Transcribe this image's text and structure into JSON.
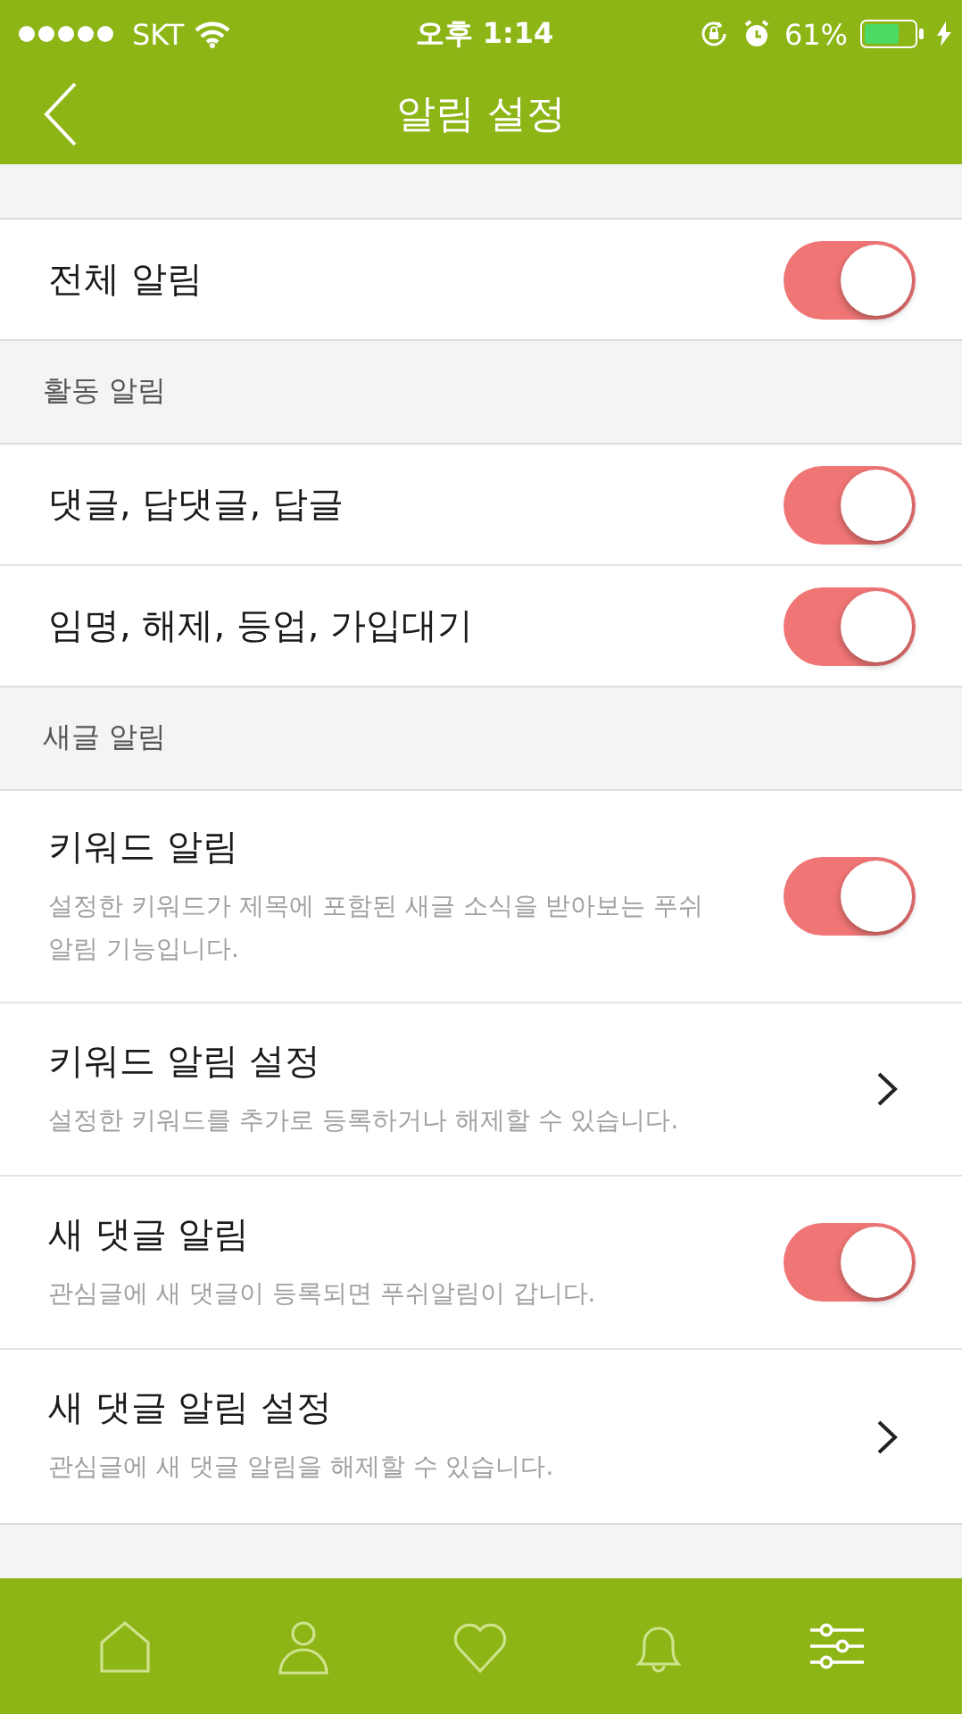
{
  "status_bar": {
    "carrier": "SKT",
    "time": "오후 1:14",
    "battery_percent": "61%"
  },
  "nav": {
    "title": "알림 설정"
  },
  "sections": [
    {
      "rows": [
        {
          "kind": "toggle",
          "title": "전체 알림",
          "on": true
        }
      ]
    },
    {
      "header": "활동 알림",
      "rows": [
        {
          "kind": "toggle",
          "title": "댓글, 답댓글, 답글",
          "on": true
        },
        {
          "kind": "toggle",
          "title": "임명, 해제, 등업, 가입대기",
          "on": true
        }
      ]
    },
    {
      "header": "새글 알림",
      "rows": [
        {
          "kind": "toggle",
          "title": "키워드 알림",
          "description": "설정한 키워드가 제목에 포함된 새글 소식을 받아보는 푸쉬 알림 기능입니다.",
          "on": true
        },
        {
          "kind": "link",
          "title": "키워드 알림 설정",
          "description": "설정한 키워드를 추가로 등록하거나 해제할 수 있습니다."
        },
        {
          "kind": "toggle",
          "title": "새 댓글 알림",
          "description": "관심글에 새 댓글이 등록되면 푸쉬알림이 갑니다.",
          "on": true
        },
        {
          "kind": "link",
          "title": "새 댓글 알림 설정",
          "description": "관심글에 새 댓글 알림을 해제할 수 있습니다."
        }
      ]
    }
  ],
  "tab_bar": [
    {
      "kind": "home",
      "selected": false
    },
    {
      "kind": "profile",
      "selected": false
    },
    {
      "kind": "heart",
      "selected": false
    },
    {
      "kind": "bell",
      "selected": false
    },
    {
      "kind": "settings",
      "selected": true
    }
  ]
}
